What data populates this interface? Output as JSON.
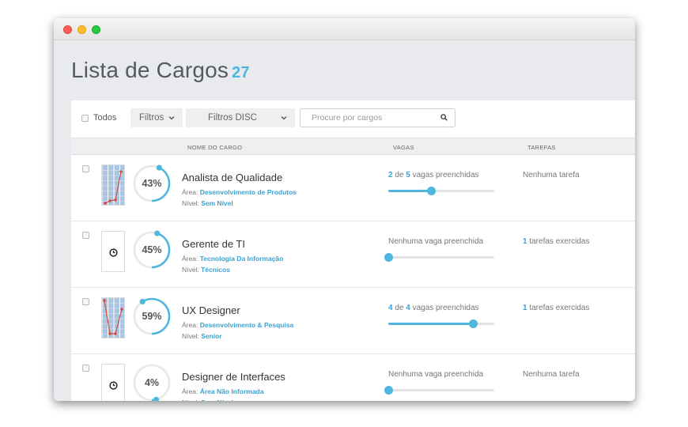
{
  "page": {
    "title": "Lista de Cargos",
    "count": "27"
  },
  "toolbar": {
    "todos_label": "Todos",
    "filtros_label": "Filtros",
    "filtros_disc_label": "Filtros DISC",
    "search_placeholder": "Procure por cargos"
  },
  "columns": {
    "nome": "NOME DO CARGO",
    "vagas": "VAGAS",
    "tarefas": "TAREFAS"
  },
  "labels": {
    "area": "Área:",
    "nivel": "Nível:",
    "de": "de",
    "vagas_preenchidas": "vagas preenchidas",
    "tarefas_exercidas": "tarefas exercidas"
  },
  "rows": [
    {
      "title": "Analista de Qualidade",
      "percent": "43%",
      "percent_value": 43,
      "area": "Desenvolvimento de Produtos",
      "nivel": "Sem Nível",
      "thumb": "chart",
      "vagas_filled": "2",
      "vagas_total": "5",
      "vagas_text": "",
      "vagas_fraction": 0.4,
      "tarefas_count": "",
      "tarefas_text": "Nenhuma tarefa"
    },
    {
      "title": "Gerente de TI",
      "percent": "45%",
      "percent_value": 45,
      "area": "Tecnologia Da Informação",
      "nivel": "Técnicos",
      "thumb": "clock",
      "vagas_filled": "",
      "vagas_total": "",
      "vagas_text": "Nenhuma vaga preenchida",
      "vagas_fraction": 0,
      "tarefas_count": "1",
      "tarefas_text": "tarefas exercidas"
    },
    {
      "title": "UX Designer",
      "percent": "59%",
      "percent_value": 59,
      "area": "Desenvolvimento & Pesquisa",
      "nivel": "Senior",
      "thumb": "chart",
      "vagas_filled": "4",
      "vagas_total": "4",
      "vagas_text": "",
      "vagas_fraction": 0.8,
      "tarefas_count": "1",
      "tarefas_text": "tarefas exercidas"
    },
    {
      "title": "Designer de Interfaces",
      "percent": "4%",
      "percent_value": 4,
      "area": "Área Não Informada",
      "nivel": "Sem Nível",
      "thumb": "clock",
      "vagas_filled": "",
      "vagas_total": "",
      "vagas_text": "Nenhuma vaga preenchida",
      "vagas_fraction": 0,
      "tarefas_count": "",
      "tarefas_text": "Nenhuma tarefa"
    }
  ],
  "colors": {
    "accent": "#4fb6dd",
    "link": "#3aa3d3",
    "chart_line": "#d24a3c",
    "chart_bg": "#8fb0d8"
  }
}
